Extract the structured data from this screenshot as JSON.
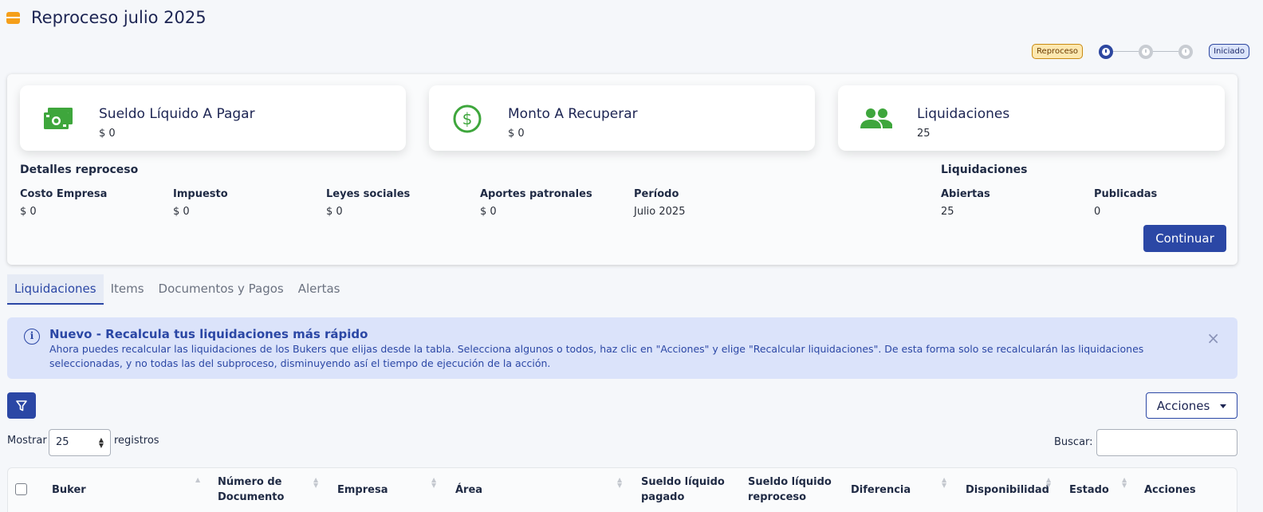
{
  "page": {
    "title": "Reproceso julio 2025"
  },
  "status": {
    "type_badge": "Reproceso",
    "state_badge": "Iniciado"
  },
  "kpis": [
    {
      "title": "Sueldo Líquido A Pagar",
      "value": "$ 0",
      "icon": "money-bill-icon"
    },
    {
      "title": "Monto A Recuperar",
      "value": "$ 0",
      "icon": "dollar-circle-icon"
    },
    {
      "title": "Liquidaciones",
      "value": "25",
      "icon": "people-icon"
    }
  ],
  "details": {
    "heading": "Detalles reproceso",
    "fields": [
      {
        "label": "Costo Empresa",
        "value": "$ 0"
      },
      {
        "label": "Impuesto",
        "value": "$ 0"
      },
      {
        "label": "Leyes sociales",
        "value": "$ 0"
      },
      {
        "label": "Aportes patronales",
        "value": "$ 0"
      },
      {
        "label": "Período",
        "value": "Julio 2025"
      }
    ]
  },
  "liquidaciones_summary": {
    "heading": "Liquidaciones",
    "fields": [
      {
        "label": "Abiertas",
        "value": "25"
      },
      {
        "label": "Publicadas",
        "value": "0"
      }
    ]
  },
  "continue_button": "Continuar",
  "tabs": [
    {
      "label": "Liquidaciones",
      "active": true
    },
    {
      "label": "Items",
      "active": false
    },
    {
      "label": "Documentos y Pagos",
      "active": false
    },
    {
      "label": "Alertas",
      "active": false
    }
  ],
  "alert": {
    "title": "Nuevo - Recalcula tus liquidaciones más rápido",
    "body": "Ahora puedes recalcular las liquidaciones de los Bukers que elijas desde la tabla. Selecciona algunos o todos, haz clic en \"Acciones\" y elige \"Recalcular liquidaciones\". De esta forma solo se recalcularán las liquidaciones seleccionadas, y no todas las del subproceso, disminuyendo así el tiempo de ejecución de la acción.",
    "close": "×"
  },
  "toolbar": {
    "acciones_label": "Acciones"
  },
  "list_controls": {
    "show_label": "Mostrar",
    "page_size": "25",
    "records_label": "registros",
    "search_label": "Buscar:"
  },
  "table": {
    "columns": [
      "Buker",
      "Número de Documento",
      "Empresa",
      "Área",
      "Sueldo líquido pagado",
      "Sueldo líquido reproceso",
      "Diferencia",
      "Disponibilidad",
      "Estado",
      "Acciones"
    ]
  },
  "colors": {
    "primary": "#2b47a5",
    "accent_green": "#3ea63c",
    "title_icon": "#f59f1a",
    "alert_bg": "#dbe3fa"
  }
}
